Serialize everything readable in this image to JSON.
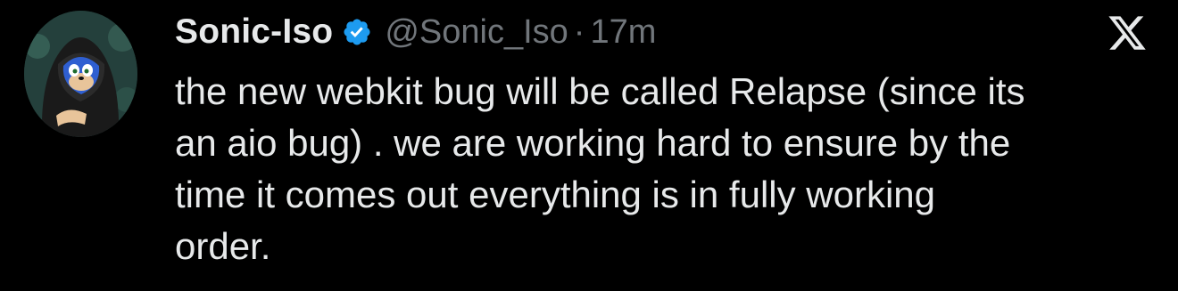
{
  "tweet": {
    "author": {
      "display_name": "Sonic-Iso",
      "handle": "@Sonic_Iso",
      "verified": true,
      "avatar_icon": "avatar-image"
    },
    "separator": "·",
    "time": "17m",
    "text": "the new webkit bug will be called Relapse (since its\nan aio bug) . we are working hard to ensure by the\ntime it comes out everything is in fully working\norder.",
    "platform_icon": "x-logo-icon"
  },
  "colors": {
    "background": "#000000",
    "text_primary": "#e7e9ea",
    "text_secondary": "#71767b",
    "verified_badge": "#1d9bf0"
  }
}
